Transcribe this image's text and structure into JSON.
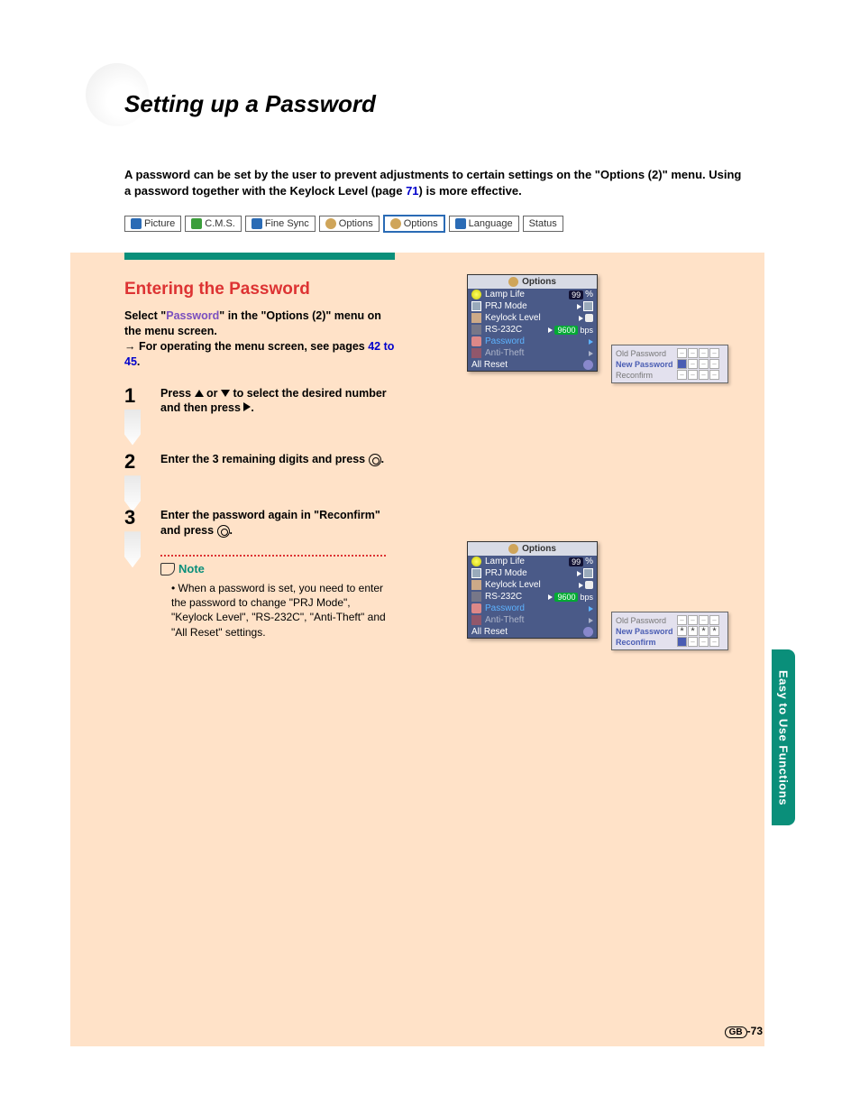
{
  "title": "Setting up a Password",
  "intro": {
    "t1": "A password can be set by the user to prevent adjustments to certain settings on the \"Options (2)\" menu. Using a password together with the Keylock Level (page ",
    "link": "71",
    "t2": ") is more effective."
  },
  "tabs": [
    "Picture",
    "C.M.S.",
    "Fine Sync",
    "Options",
    "Options",
    "Language",
    "Status"
  ],
  "section_head": "Entering the Password",
  "select_para": {
    "p1": "Select \"",
    "hl": "Password",
    "p2": "\" in the \"Options (2)\" menu on the menu screen.",
    "p3": "→ For operating the menu screen, see pages ",
    "lk": "42 to 45",
    "p4": "."
  },
  "steps": {
    "s1a": "Press ",
    "s1b": " or ",
    "s1c": " to select the desired number and then press ",
    "s1d": ".",
    "s2a": "Enter the 3 remaining digits and press ",
    "s2b": ".",
    "s3a": "Enter the password again in \"Reconfirm\" and press ",
    "s3b": "."
  },
  "note_label": "Note",
  "note_text": "When a password is set, you need to enter the password to change \"PRJ Mode\", \"Keylock Level\", \"RS-232C\", \"Anti-Theft\" and \"All Reset\" settings.",
  "osd": {
    "head": "Options",
    "lamp": "Lamp Life",
    "lamp_val": "99",
    "lamp_pct": "%",
    "prj": "PRJ Mode",
    "keylock": "Keylock Level",
    "rs": "RS-232C",
    "rs_val": "9600",
    "rs_bps": "bps",
    "password": "Password",
    "anti": "Anti-Theft",
    "reset": "All Reset"
  },
  "pw": {
    "old": "Old Password",
    "new": "New Password",
    "re": "Reconfirm"
  },
  "side_tab": "Easy to Use Functions",
  "page_gb": "GB",
  "page_num": "-73"
}
